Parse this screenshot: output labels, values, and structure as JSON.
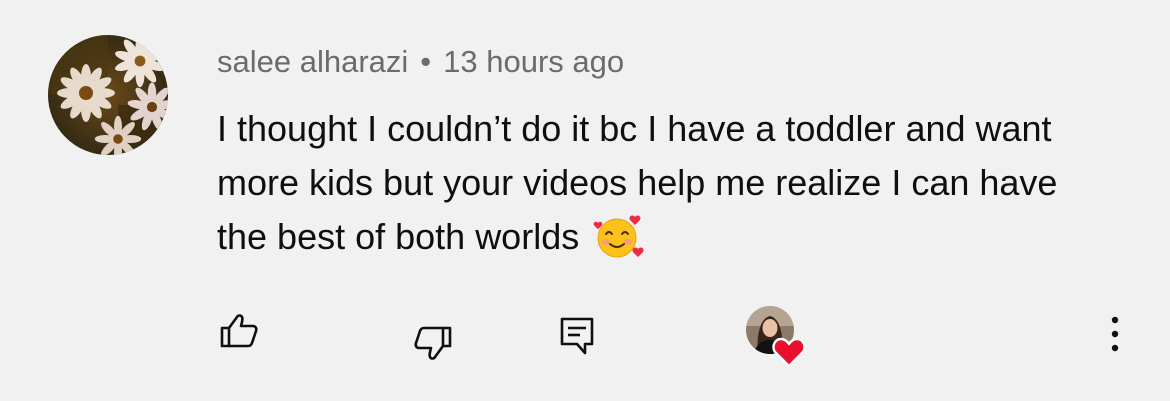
{
  "comment": {
    "author": "salee alharazi",
    "separator": "•",
    "timestamp": "13 hours ago",
    "text": "I thought I couldn’t do it bc I have a toddler and want more kids but your videos help me realize I can have the best of both worlds",
    "emoji_icon": "smiling-face-with-hearts-icon"
  },
  "actions": {
    "like_icon": "thumbs-up-icon",
    "dislike_icon": "thumbs-down-icon",
    "reply_icon": "reply-comment-icon",
    "creator_heart_icon": "heart-icon",
    "more_icon": "more-vertical-icon"
  },
  "colors": {
    "background": "#f1f1f1",
    "text": "#0f0f0f",
    "meta_text": "#6b6b6b",
    "heart": "#e8102c"
  }
}
